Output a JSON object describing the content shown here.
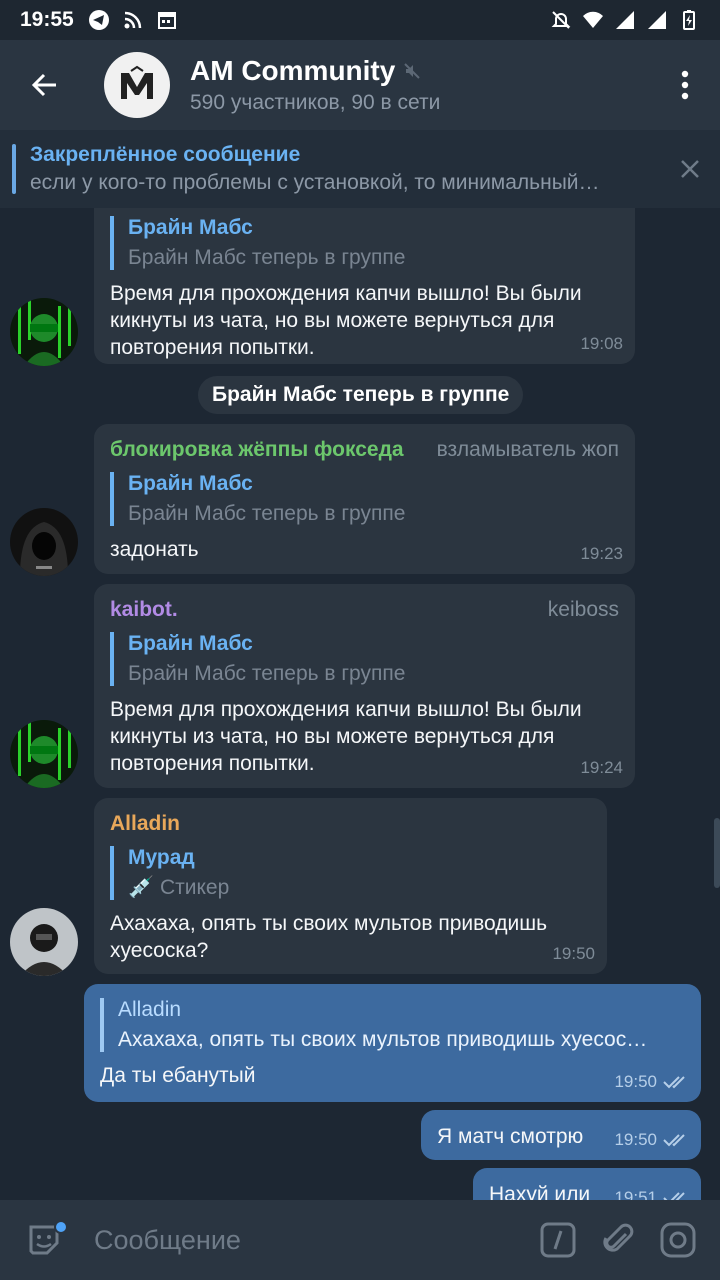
{
  "status_bar": {
    "time": "19:55"
  },
  "header": {
    "title": "AM Community",
    "subtitle": "590 участников, 90 в сети"
  },
  "pinned": {
    "title": "Закреплённое сообщение",
    "text": "если у кого-то проблемы с установкой, то минимальный…"
  },
  "messages": [
    {
      "reply_name": "Брайн Мабс",
      "reply_text": "Брайн Мабс теперь в группе",
      "text": "Время для прохождения капчи вышло! Вы были кикнуты из чата, но вы можете вернуться для повторения попытки.",
      "time": "19:08"
    },
    {
      "service_text": "Брайн Мабс теперь в группе"
    },
    {
      "sender": "блокировка жёппы фокседа",
      "sender_color": "#6cc76c",
      "role": "взламыватель жоп",
      "reply_name": "Брайн Мабс",
      "reply_text": "Брайн Мабс теперь в группе",
      "text": "задонать",
      "time": "19:23"
    },
    {
      "sender": "kaibot.",
      "sender_color": "#b28be5",
      "role": "keiboss",
      "reply_name": "Брайн Мабс",
      "reply_text": "Брайн Мабс теперь в группе",
      "text": "Время для прохождения капчи вышло! Вы были кикнуты из чата, но вы можете вернуться для повторения попытки.",
      "time": "19:24"
    },
    {
      "sender": "Alladin",
      "sender_color": "#e9a85a",
      "reply_name": "Мурад",
      "reply_text": "💉 Стикер",
      "text": "Ахахаха, опять ты своих мультов приводишь хуесоска?",
      "time": "19:50"
    },
    {
      "reply_name": "Alladin",
      "reply_text": "Ахахаха, опять ты своих мультов приводишь хуесос…",
      "text": "Да ты ебанутый",
      "time": "19:50"
    },
    {
      "text": "Я матч смотрю",
      "time": "19:50"
    },
    {
      "text": "Нахуй или",
      "time": "19:51"
    }
  ],
  "input": {
    "placeholder": "Сообщение"
  }
}
